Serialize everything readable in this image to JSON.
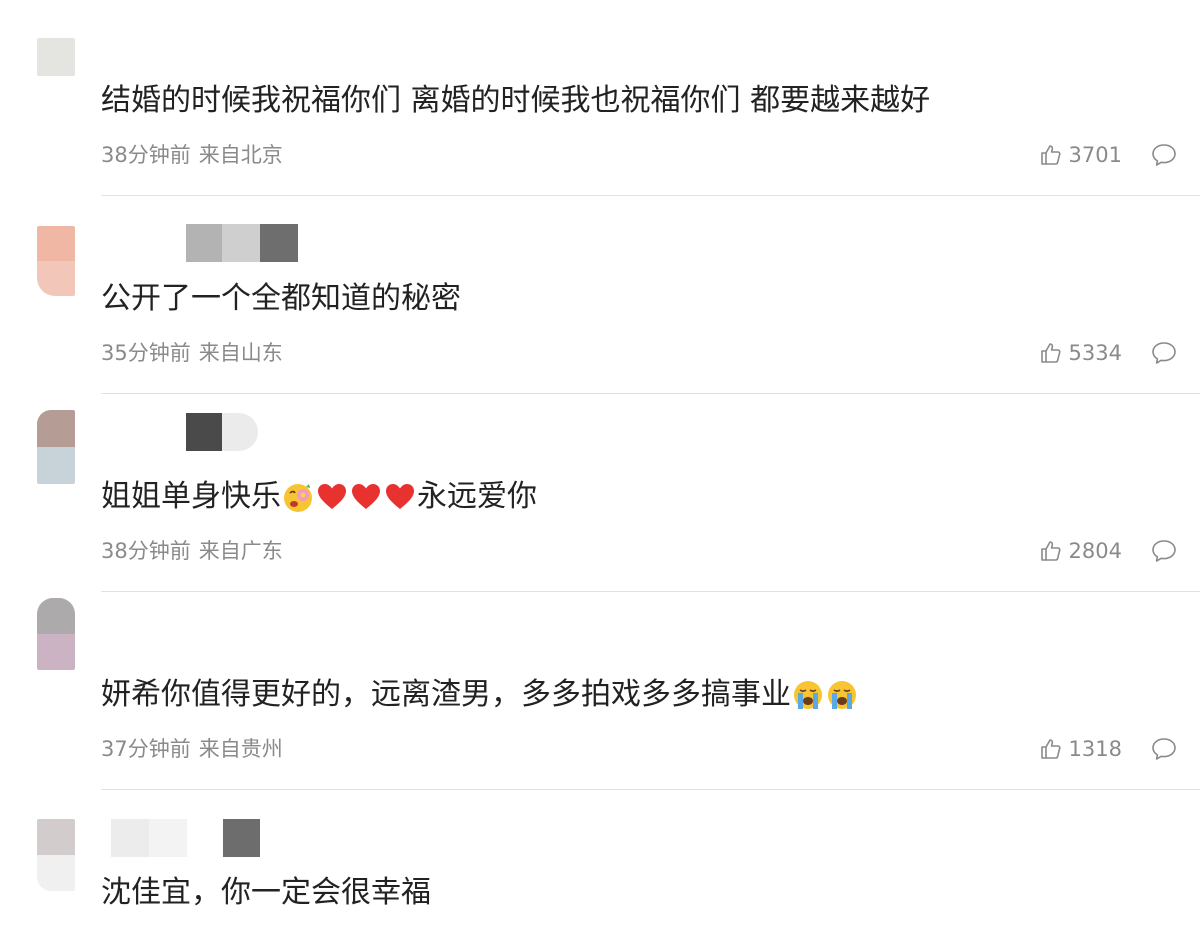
{
  "comments": [
    {
      "text": "结婚的时候我祝福你们 离婚的时候我也祝福你们 都要越来越好",
      "time": "38分钟前",
      "location": "来自北京",
      "likes": "3701",
      "emojis": []
    },
    {
      "text": "公开了一个全都知道的秘密",
      "time": "35分钟前",
      "location": "来自山东",
      "likes": "5334",
      "emojis": []
    },
    {
      "text_before": "姐姐单身快乐",
      "text_after": "永远爱你",
      "time": "38分钟前",
      "location": "来自广东",
      "likes": "2804",
      "emojis": [
        "flower-face-emoji",
        "red-heart-emoji",
        "red-heart-emoji",
        "red-heart-emoji"
      ]
    },
    {
      "text": "妍希你值得更好的，远离渣男，多多拍戏多多搞事业",
      "time": "37分钟前",
      "location": "来自贵州",
      "likes": "1318",
      "emojis": [
        "crying-face-emoji",
        "crying-face-emoji"
      ]
    },
    {
      "text": "沈佳宜，你一定会很幸福",
      "emojis": []
    }
  ],
  "colors": {
    "text": "#222222",
    "meta": "#8a8a8a",
    "divider": "#e2e2e2",
    "heart": "#e8322f",
    "emoji_face": "#f7c531"
  }
}
